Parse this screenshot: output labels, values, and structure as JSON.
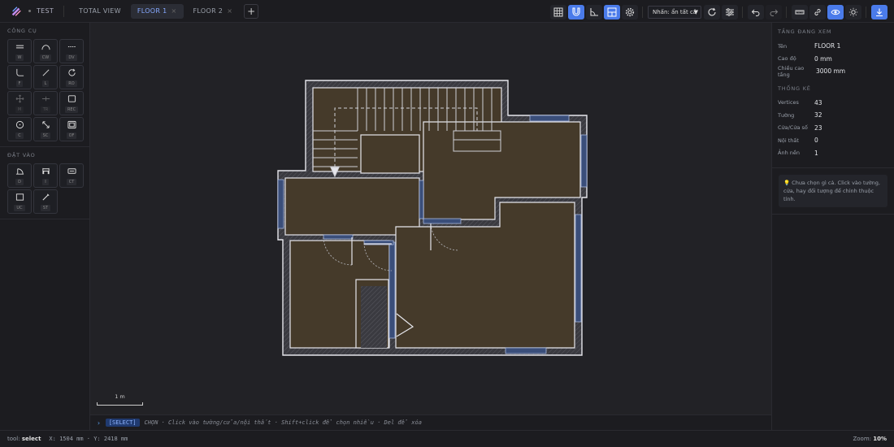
{
  "header": {
    "project": "TEST",
    "tabs": [
      {
        "label": "TOTAL VIEW",
        "closable": false,
        "active": false
      },
      {
        "label": "FLOOR 1",
        "closable": true,
        "active": true
      },
      {
        "label": "FLOOR 2",
        "closable": true,
        "active": false
      }
    ],
    "add_tab": "+",
    "close_glyph": "×",
    "filter_select": "Nhấn: ẩn tất cả"
  },
  "left": {
    "tools_title": "CÔNG CỤ",
    "tools": [
      {
        "icon": "wall-icon",
        "key": "W"
      },
      {
        "icon": "curved-wall-icon",
        "key": "CW"
      },
      {
        "icon": "dashed-line-icon",
        "key": "DV"
      },
      {
        "icon": "fillet-icon",
        "key": "F"
      },
      {
        "icon": "line-icon",
        "key": "L"
      },
      {
        "icon": "rotate-icon",
        "key": "RO"
      },
      {
        "icon": "move-icon",
        "key": "M"
      },
      {
        "icon": "trim-icon",
        "key": "TR"
      },
      {
        "icon": "rectangle-icon",
        "key": "REC"
      },
      {
        "icon": "circle-icon",
        "key": "C"
      },
      {
        "icon": "scale-icon",
        "key": "SC"
      },
      {
        "icon": "offset-icon",
        "key": "OF"
      }
    ],
    "place_title": "ĐẶT VÀO",
    "place": [
      {
        "icon": "door-icon",
        "key": "D"
      },
      {
        "icon": "window-icon",
        "key": "I"
      },
      {
        "icon": "cabinet-icon",
        "key": "CT"
      },
      {
        "icon": "furniture-icon",
        "key": "UC"
      },
      {
        "icon": "stair-icon",
        "key": "ST"
      }
    ]
  },
  "canvas": {
    "scale_label": "1 m"
  },
  "console": {
    "prompt": "›",
    "mode": "[SELECT]",
    "message": "CHỌN · Click vào tường/cửa/nội thất · Shift+click để chọn nhiều · Del để xóa"
  },
  "right": {
    "floor_title": "TẦNG ĐANG XEM",
    "floor": [
      {
        "key": "Tên",
        "value": "FLOOR 1"
      },
      {
        "key": "Cao độ",
        "value": "0 mm"
      },
      {
        "key": "Chiều cao tầng",
        "value": "3000 mm"
      }
    ],
    "stats_title": "THỐNG KÊ",
    "stats": [
      {
        "key": "Vertices",
        "value": "43"
      },
      {
        "key": "Tường",
        "value": "32"
      },
      {
        "key": "Cửa/Cửa số",
        "value": "23"
      },
      {
        "key": "Nội thất",
        "value": "0"
      },
      {
        "key": "Ảnh nền",
        "value": "1"
      }
    ],
    "hint_icon": "lightbulb-icon",
    "hint": "💡 Chưa chọn gì cả. Click vào tường, cửa, hay đối tượng để chỉnh thuộc tính."
  },
  "status": {
    "tool_label": "tool:",
    "tool": "select",
    "coords": "X: 1504 mm · Y: 2418 mm",
    "zoom_label": "Zoom:",
    "zoom": "10%"
  },
  "colors": {
    "accent": "#4a7bea",
    "floor_fill": "#453a2a",
    "wall": "#e6e6ec",
    "window": "#3a4e7a"
  }
}
